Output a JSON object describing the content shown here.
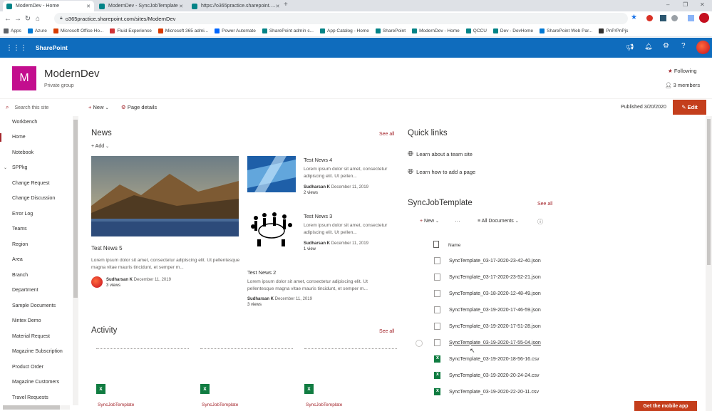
{
  "browser": {
    "tabs": [
      {
        "label": "ModernDev - Home",
        "active": true
      },
      {
        "label": "ModernDev - SyncJobTemplate",
        "active": false
      },
      {
        "label": "https://o365practice.sharepoint.…",
        "active": false
      }
    ],
    "url": "o365practice.sharepoint.com/sites/ModernDev",
    "bookmarks": [
      {
        "label": "Apps",
        "color": "#5f6368"
      },
      {
        "label": "Azure",
        "color": "#0078d4"
      },
      {
        "label": "Microsoft Office Ho...",
        "color": "#d83b01"
      },
      {
        "label": "Fluid Experience",
        "color": "#d13438"
      },
      {
        "label": "Microsoft 365 admi...",
        "color": "#d83b01"
      },
      {
        "label": "Power Automate",
        "color": "#0066ff"
      },
      {
        "label": "SharePoint admin c...",
        "color": "#038387"
      },
      {
        "label": "App Catalog - Home",
        "color": "#038387"
      },
      {
        "label": "SharePoint",
        "color": "#038387"
      },
      {
        "label": "ModernDev - Home",
        "color": "#038387"
      },
      {
        "label": "QCCU",
        "color": "#038387"
      },
      {
        "label": "Dev - DevHome",
        "color": "#038387"
      },
      {
        "label": "SharePoint Web Par...",
        "color": "#0078d4"
      },
      {
        "label": "PnP/PnPjs",
        "color": "#323130"
      }
    ]
  },
  "suite": {
    "app_name": "SharePoint",
    "accent": "#0f6cbd"
  },
  "site": {
    "logo_letter": "M",
    "logo_color": "#c30e8e",
    "name": "ModernDev",
    "type": "Private group",
    "following": "Following",
    "members": "3 members"
  },
  "commands": {
    "search_placeholder": "Search this site",
    "new": "New",
    "page_details": "Page details",
    "published": "Published 3/20/2020",
    "edit": "Edit"
  },
  "nav": [
    "Workbench",
    "Home",
    "Notebook",
    "SPPkg",
    "Change Request",
    "Change Discussion",
    "Error Log",
    "Teams",
    "Region",
    "Area",
    "Branch",
    "Department",
    "Sample Documents",
    "Nintex Demo",
    "Material Request",
    "Magazine Subscription",
    "Product Order",
    "Magazine Customers",
    "Travel Requests"
  ],
  "news": {
    "title": "News",
    "see_all": "See all",
    "add": "Add",
    "main": {
      "title": "Test News 5",
      "body": "Lorem ipsum dolor sit amet, consectetur adipiscing elit. Ut pellentesque magna vitae mauris tincidunt, et semper m...",
      "author": "Sudharsan K",
      "date": "December 11, 2019",
      "views": "3 views"
    },
    "side": [
      {
        "title": "Test News 4",
        "body": "Lorem ipsum dolor sit amet, consectetur adipiscing elit. Ut pellen...",
        "author": "Sudharsan K",
        "date": "December 11, 2019",
        "views": "2 views"
      },
      {
        "title": "Test News 3",
        "body": "Lorem ipsum dolor sit amet, consectetur adipiscing elit. Ut pellen...",
        "author": "Sudharsan K",
        "date": "December 11, 2019",
        "views": "1 view"
      },
      {
        "title": "Test News 2",
        "body": "Lorem ipsum dolor sit amet, consectetur adipiscing elit. Ut pellentesque magna vitae mauris tincidunt, et semper m...",
        "author": "Sudharsan K",
        "date": "December 11, 2019",
        "views": "3 views"
      }
    ]
  },
  "activity": {
    "title": "Activity",
    "see_all": "See all",
    "cards": [
      {
        "label": "SyncJobTemplate"
      },
      {
        "label": "SyncJobTemplate"
      },
      {
        "label": "SyncJobTemplate"
      }
    ]
  },
  "quick_links": {
    "title": "Quick links",
    "items": [
      "Learn about a team site",
      "Learn how to add a page"
    ]
  },
  "library": {
    "title": "SyncJobTemplate",
    "see_all": "See all",
    "new": "New",
    "view": "All Documents",
    "name_header": "Name",
    "files": [
      {
        "name": "SyncTemplate_03-17-2020-23-42-40.json",
        "type": "json"
      },
      {
        "name": "SyncTemplate_03-17-2020-23-52-21.json",
        "type": "json"
      },
      {
        "name": "SyncTemplate_03-18-2020-12-48-49.json",
        "type": "json"
      },
      {
        "name": "SyncTemplate_03-19-2020-17-46-59.json",
        "type": "json"
      },
      {
        "name": "SyncTemplate_03-19-2020-17-51-28.json",
        "type": "json"
      },
      {
        "name": "SyncTemplate_03-19-2020-17-55-04.json",
        "type": "json"
      },
      {
        "name": "SyncTemplate_03-19-2020-18-56-16.csv",
        "type": "csv"
      },
      {
        "name": "SyncTemplate_03-19-2020-20-24-24.csv",
        "type": "csv"
      },
      {
        "name": "SyncTemplate_03-19-2020-22-20-11.csv",
        "type": "csv"
      }
    ]
  },
  "mobile_button": "Get the mobile app"
}
